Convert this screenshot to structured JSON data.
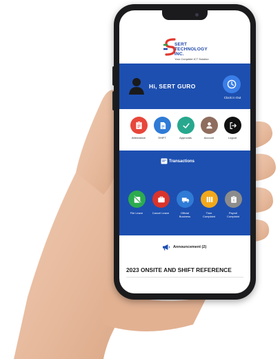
{
  "logo": {
    "name_line1": "SERT",
    "name_line2": "TECHNOLOGY",
    "name_line3": "INC.",
    "tagline": "Your Complete ICT Solution"
  },
  "header": {
    "greeting": "Hi, SERT GURO",
    "clock_label": "Clock in Out"
  },
  "menu_row1": [
    {
      "label": "Attendance",
      "icon": "clipboard-icon",
      "color": "#e8463a"
    },
    {
      "label": "SHIFT",
      "icon": "document-icon",
      "color": "#2f7bd6"
    },
    {
      "label": "Approvals",
      "icon": "check-icon",
      "color": "#27a88e"
    },
    {
      "label": "Account",
      "icon": "user-icon",
      "color": "#8f6d5e"
    },
    {
      "label": "Logout",
      "icon": "logout-icon",
      "color": "#111111"
    }
  ],
  "transactions": {
    "title": "Transactions"
  },
  "menu_row2": [
    {
      "label_line1": "File Leave",
      "label_line2": "",
      "icon": "leave-icon",
      "color": "#2cab4f"
    },
    {
      "label_line1": "Cancel Leave",
      "label_line2": "",
      "icon": "briefcase-icon",
      "color": "#d9342b"
    },
    {
      "label_line1": "Official",
      "label_line2": "Business",
      "icon": "truck-icon",
      "color": "#2f7bd6"
    },
    {
      "label_line1": "Time",
      "label_line2": "Complaint",
      "icon": "columns-icon",
      "color": "#f1a81c"
    },
    {
      "label_line1": "Payroll",
      "label_line2": "Complaint",
      "icon": "payroll-icon",
      "color": "#8c8c8c"
    }
  ],
  "announcement": {
    "label": "Announcement (2)"
  },
  "footer": {
    "title": "2023 ONSITE AND SHIFT REFERENCE"
  },
  "colors": {
    "primary_blue": "#1d4fb0",
    "phone_body": "#1b1b1d"
  }
}
